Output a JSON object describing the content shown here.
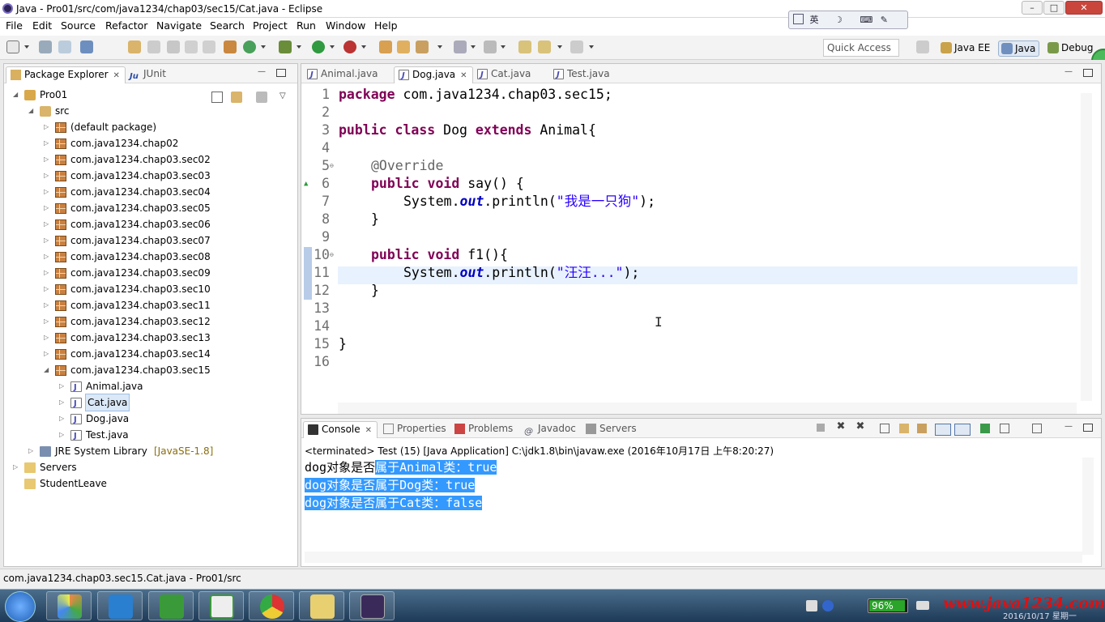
{
  "window": {
    "title": "Java - Pro01/src/com/java1234/chap03/sec15/Cat.java - Eclipse"
  },
  "ime": {
    "label": "英"
  },
  "menu": [
    "File",
    "Edit",
    "Source",
    "Refactor",
    "Navigate",
    "Search",
    "Project",
    "Run",
    "Window",
    "Help"
  ],
  "toolbar": {
    "quick_access": "Quick Access",
    "perspectives": [
      "Java EE",
      "Java",
      "Debug"
    ]
  },
  "package_explorer": {
    "tabs": [
      "Package Explorer",
      "JUnit"
    ],
    "items": [
      {
        "label": "Pro01",
        "level": 0,
        "kind": "project",
        "expanded": true
      },
      {
        "label": "src",
        "level": 1,
        "kind": "srcfolder",
        "expanded": true
      },
      {
        "label": "(default package)",
        "level": 2,
        "kind": "pkg"
      },
      {
        "label": "com.java1234.chap02",
        "level": 2,
        "kind": "pkg"
      },
      {
        "label": "com.java1234.chap03.sec02",
        "level": 2,
        "kind": "pkg"
      },
      {
        "label": "com.java1234.chap03.sec03",
        "level": 2,
        "kind": "pkg"
      },
      {
        "label": "com.java1234.chap03.sec04",
        "level": 2,
        "kind": "pkg"
      },
      {
        "label": "com.java1234.chap03.sec05",
        "level": 2,
        "kind": "pkg"
      },
      {
        "label": "com.java1234.chap03.sec06",
        "level": 2,
        "kind": "pkg"
      },
      {
        "label": "com.java1234.chap03.sec07",
        "level": 2,
        "kind": "pkg"
      },
      {
        "label": "com.java1234.chap03.sec08",
        "level": 2,
        "kind": "pkg"
      },
      {
        "label": "com.java1234.chap03.sec09",
        "level": 2,
        "kind": "pkg"
      },
      {
        "label": "com.java1234.chap03.sec10",
        "level": 2,
        "kind": "pkg"
      },
      {
        "label": "com.java1234.chap03.sec11",
        "level": 2,
        "kind": "pkg"
      },
      {
        "label": "com.java1234.chap03.sec12",
        "level": 2,
        "kind": "pkg"
      },
      {
        "label": "com.java1234.chap03.sec13",
        "level": 2,
        "kind": "pkg"
      },
      {
        "label": "com.java1234.chap03.sec14",
        "level": 2,
        "kind": "pkg"
      },
      {
        "label": "com.java1234.chap03.sec15",
        "level": 2,
        "kind": "pkg",
        "expanded": true
      },
      {
        "label": "Animal.java",
        "level": 3,
        "kind": "java"
      },
      {
        "label": "Cat.java",
        "level": 3,
        "kind": "java",
        "selected": true
      },
      {
        "label": "Dog.java",
        "level": 3,
        "kind": "java"
      },
      {
        "label": "Test.java",
        "level": 3,
        "kind": "java"
      },
      {
        "label": "JRE System Library",
        "suffix": "[JavaSE-1.8]",
        "level": 1,
        "kind": "lib"
      },
      {
        "label": "Servers",
        "level": 0,
        "kind": "folder"
      },
      {
        "label": "StudentLeave",
        "level": 0,
        "kind": "folder",
        "noarrow": true
      }
    ]
  },
  "editor": {
    "tabs": [
      {
        "label": "Animal.java"
      },
      {
        "label": "Dog.java",
        "active": true
      },
      {
        "label": "Cat.java"
      },
      {
        "label": "Test.java"
      }
    ],
    "lines": [
      "1",
      "2",
      "3",
      "4",
      "5",
      "6",
      "7",
      "8",
      "9",
      "10",
      "11",
      "12",
      "13",
      "14",
      "15",
      "16"
    ]
  },
  "code": {
    "l1_kw": "package",
    "l1_rest": " com.java1234.chap03.sec15;",
    "l3_kw1": "public",
    "l3_kw2": "class",
    "l3_name": " Dog ",
    "l3_kw3": "extends",
    "l3_rest": " Animal{",
    "l5_an": "@Override",
    "l6_kw1": "public",
    "l6_kw2": "void",
    "l6_rest": " say() {",
    "l7_a": "System.",
    "l7_out": "out",
    "l7_b": ".println(",
    "l7_str": "\"我是一只狗\"",
    "l7_c": ");",
    "l8": "}",
    "l10_kw1": "public",
    "l10_kw2": "void",
    "l10_rest": " f1(){",
    "l11_a": "System.",
    "l11_out": "out",
    "l11_b": ".println(",
    "l11_str": "\"汪汪...\"",
    "l11_c": ");",
    "l12": "}",
    "l15": "}"
  },
  "console": {
    "tabs": [
      "Console",
      "Properties",
      "Problems",
      "Javadoc",
      "Servers"
    ],
    "status": "<terminated> Test (15) [Java Application] C:\\jdk1.8\\bin\\javaw.exe (2016年10月17日 上午8:20:27)",
    "out1_plain": "dog对象是否",
    "out1_sel": "属于Animal类：true",
    "out2": "dog对象是否属于Dog类：true",
    "out3": "dog对象是否属于Cat类：false"
  },
  "statusbar": {
    "text": "com.java1234.chap03.sec15.Cat.java - Pro01/src"
  },
  "taskbar": {
    "battery": "96%",
    "watermark": "www.java1234.com",
    "date": "2016/10/17 星期一"
  }
}
